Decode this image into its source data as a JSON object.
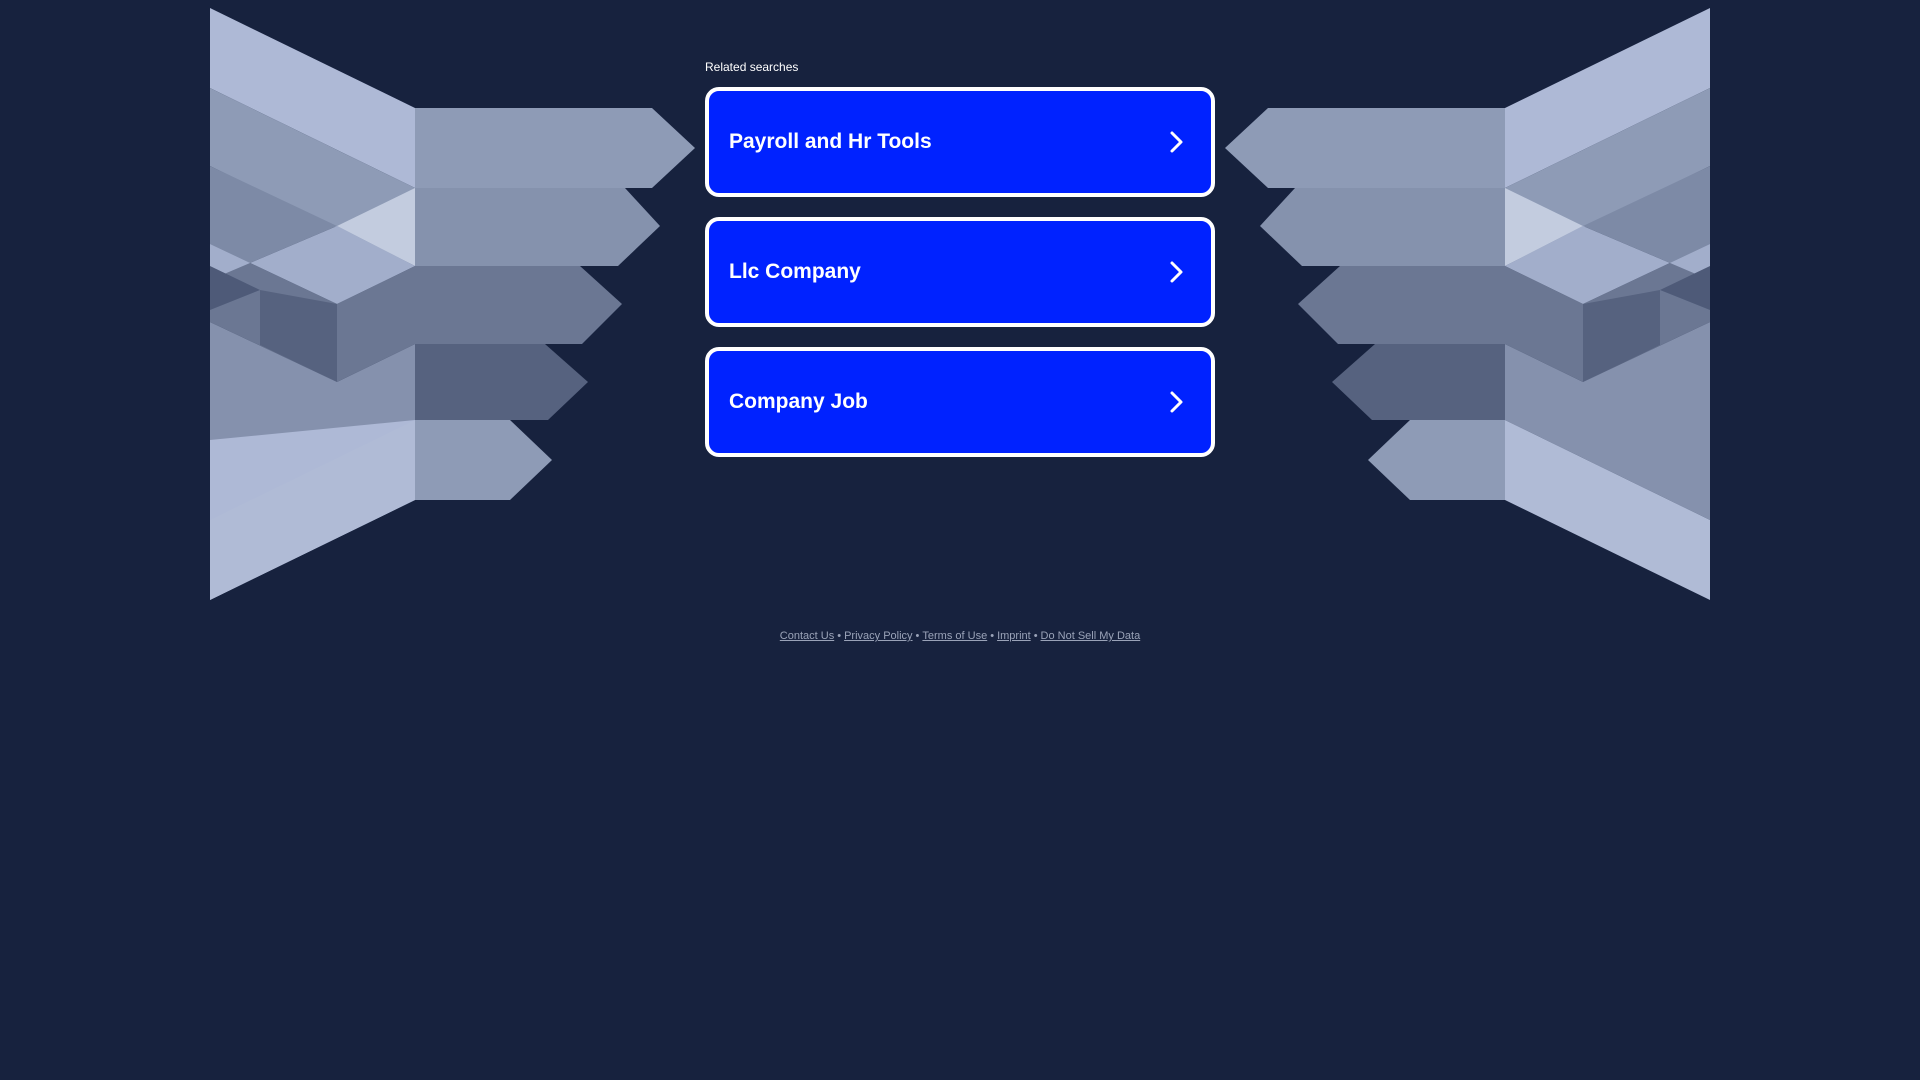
{
  "related": {
    "heading": "Related searches",
    "items": [
      {
        "label": "Payroll and Hr Tools"
      },
      {
        "label": "Llc Company"
      },
      {
        "label": "Company Job"
      }
    ]
  },
  "footer": {
    "links": [
      {
        "label": "Contact Us"
      },
      {
        "label": "Privacy Policy"
      },
      {
        "label": "Terms of Use"
      },
      {
        "label": "Imprint"
      },
      {
        "label": "Do Not Sell My Data"
      }
    ],
    "separator": "•"
  },
  "colors": {
    "background": "#17223e",
    "button": "#0022ff",
    "button_border": "#ffffff"
  },
  "icons": {
    "chevron": "chevron-right-icon"
  }
}
